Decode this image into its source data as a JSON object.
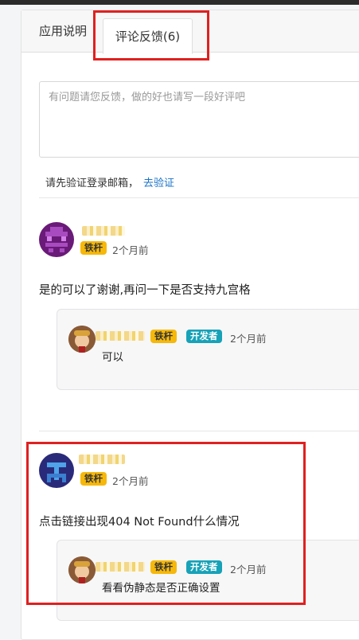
{
  "tabs": [
    {
      "label": "应用说明"
    },
    {
      "label": "评论反馈(6)"
    }
  ],
  "feedback": {
    "placeholder": "有问题请您反馈，做的好也请写一段好评吧",
    "verify_text": "请先验证登录邮箱，",
    "verify_link": "去验证"
  },
  "comments": [
    {
      "badge": "铁杆",
      "time": "2个月前",
      "content": "是的可以了谢谢,再问一下是否支持九宫格",
      "reply": {
        "badges": [
          "铁杆",
          "开发者"
        ],
        "time": "2个月前",
        "content": "可以"
      }
    },
    {
      "badge": "铁杆",
      "time": "2个月前",
      "content": "点击链接出现404 Not Found什么情况",
      "reply": {
        "badges": [
          "铁杆",
          "开发者"
        ],
        "time": "2个月前",
        "content": "看看伪静态是否正确设置"
      }
    }
  ],
  "colors": {
    "accent_link": "#1a73c8",
    "badge_iron": "#f6b80a",
    "badge_dev": "#17a2b8",
    "highlight": "#e02020"
  },
  "icons": [
    "user-avatar-purple",
    "user-avatar-blue",
    "developer-avatar"
  ]
}
